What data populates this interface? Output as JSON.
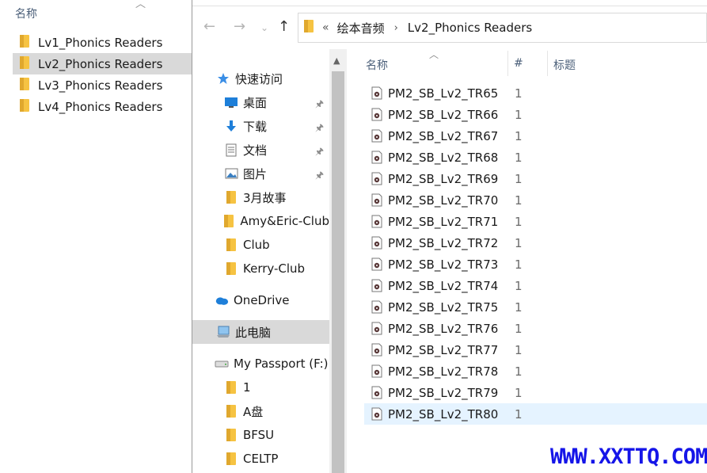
{
  "left_window": {
    "column_header": "名称",
    "folders": [
      {
        "label": "Lv1_Phonics Readers",
        "selected": false
      },
      {
        "label": "Lv2_Phonics Readers",
        "selected": true
      },
      {
        "label": "Lv3_Phonics Readers",
        "selected": false
      },
      {
        "label": "Lv4_Phonics Readers",
        "selected": false
      }
    ]
  },
  "address_bar": {
    "overflow": "«",
    "crumbs": [
      "绘本音频",
      "Lv2_Phonics Readers"
    ]
  },
  "navigation": {
    "quick_access": "快速访问",
    "pinned": [
      {
        "label": "桌面",
        "icon": "desktop-icon"
      },
      {
        "label": "下载",
        "icon": "download-icon"
      },
      {
        "label": "文档",
        "icon": "document-icon"
      },
      {
        "label": "图片",
        "icon": "picture-icon"
      }
    ],
    "folders": [
      "3月故事",
      "Amy&Eric-Club",
      "Club",
      "Kerry-Club"
    ],
    "onedrive": "OneDrive",
    "this_pc": "此电脑",
    "drive": "My Passport (F:)",
    "drive_folders": [
      "1",
      "A盘",
      "BFSU",
      "CELTP"
    ]
  },
  "file_list": {
    "columns": {
      "name": "名称",
      "number": "#",
      "title": "标题"
    },
    "files": [
      {
        "name": "PM2_SB_Lv2_TR65",
        "number": "1"
      },
      {
        "name": "PM2_SB_Lv2_TR66",
        "number": "1"
      },
      {
        "name": "PM2_SB_Lv2_TR67",
        "number": "1"
      },
      {
        "name": "PM2_SB_Lv2_TR68",
        "number": "1"
      },
      {
        "name": "PM2_SB_Lv2_TR69",
        "number": "1"
      },
      {
        "name": "PM2_SB_Lv2_TR70",
        "number": "1"
      },
      {
        "name": "PM2_SB_Lv2_TR71",
        "number": "1"
      },
      {
        "name": "PM2_SB_Lv2_TR72",
        "number": "1"
      },
      {
        "name": "PM2_SB_Lv2_TR73",
        "number": "1"
      },
      {
        "name": "PM2_SB_Lv2_TR74",
        "number": "1"
      },
      {
        "name": "PM2_SB_Lv2_TR75",
        "number": "1"
      },
      {
        "name": "PM2_SB_Lv2_TR76",
        "number": "1"
      },
      {
        "name": "PM2_SB_Lv2_TR77",
        "number": "1"
      },
      {
        "name": "PM2_SB_Lv2_TR78",
        "number": "1"
      },
      {
        "name": "PM2_SB_Lv2_TR79",
        "number": "1"
      },
      {
        "name": "PM2_SB_Lv2_TR80",
        "number": "1",
        "selected": true
      }
    ]
  },
  "watermark": "WWW.XXTTQ.COM",
  "colors": {
    "folder": "#f6c342",
    "selection": "#d9d9d9",
    "file_selection": "#e5f3ff",
    "watermark": "#1515e8"
  }
}
